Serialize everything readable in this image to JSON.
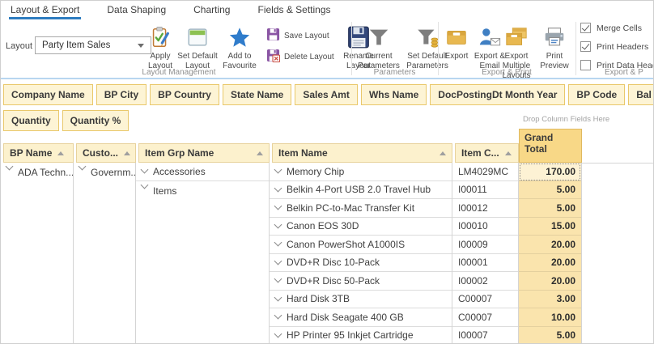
{
  "tabs": [
    {
      "label": "Layout & Export",
      "active": true
    },
    {
      "label": "Data Shaping",
      "active": false
    },
    {
      "label": "Charting",
      "active": false
    },
    {
      "label": "Fields & Settings",
      "active": false
    }
  ],
  "ribbon": {
    "layout_field": {
      "label": "Layout",
      "value": "Party Item Sales"
    },
    "layout_group": {
      "label": "Layout Management",
      "apply": "Apply Layout",
      "set_default": "Set Default Layout",
      "favourite": "Add to Favourite",
      "save": "Save Layout",
      "delete": "Delete Layout",
      "rename": "Rename Layout"
    },
    "param_group": {
      "label": "Parameters",
      "current": "Current Parameters",
      "set_default": "Set Default Parameters"
    },
    "export_group": {
      "label": "Export & Print",
      "export": "Export",
      "email": "Export & Email",
      "multiple": "Export Multiple Layouts",
      "preview": "Print Preview"
    },
    "options_group": {
      "label": "Export & P",
      "checkboxes": [
        {
          "label": "Merge Cells",
          "checked": true
        },
        {
          "label": "Print Headers",
          "checked": true
        },
        {
          "label": "Print Data Headers",
          "checked": false
        }
      ]
    }
  },
  "fields": {
    "row1": [
      "Company Name",
      "BP City",
      "BP Country",
      "State Name",
      "Sales Amt",
      "Whs Name",
      "DocPostingDt Month Year",
      "BP Code",
      "Bal Due On Doc"
    ],
    "row2": [
      "Quantity",
      "Quantity %"
    ],
    "drop_hint": "Drop Column Fields Here"
  },
  "pivot": {
    "grand_total": "Grand Total",
    "headers": {
      "c0": "BP Name",
      "c1": "Custo...",
      "c2": "Item Grp Name",
      "c3": "Item Name",
      "c4": "Item C..."
    },
    "groups": {
      "bp": "ADA Techn...",
      "customer": "Governm...",
      "grp1": "Accessories",
      "grp2": "Items"
    },
    "rows": [
      {
        "name": "Memory Chip",
        "code": "LM4029MC",
        "value": "170.00",
        "selected": true
      },
      {
        "name": "Belkin 4-Port USB 2.0 Travel Hub",
        "code": "I00011",
        "value": "5.00",
        "selected": false
      },
      {
        "name": "Belkin PC-to-Mac Transfer Kit",
        "code": "I00012",
        "value": "5.00",
        "selected": false
      },
      {
        "name": "Canon EOS 30D",
        "code": "I00010",
        "value": "15.00",
        "selected": false
      },
      {
        "name": "Canon PowerShot A1000IS",
        "code": "I00009",
        "value": "20.00",
        "selected": false
      },
      {
        "name": "DVD+R Disc 10-Pack",
        "code": "I00001",
        "value": "20.00",
        "selected": false
      },
      {
        "name": "DVD+R Disc 50-Pack",
        "code": "I00002",
        "value": "20.00",
        "selected": false
      },
      {
        "name": "Hard Disk 3TB",
        "code": "C00007",
        "value": "3.00",
        "selected": false
      },
      {
        "name": "Hard Disk Seagate 400 GB",
        "code": "C00007",
        "value": "10.00",
        "selected": false
      },
      {
        "name": "HP Printer 95 Inkjet Cartridge",
        "code": "I00007",
        "value": "5.00",
        "selected": false
      }
    ]
  },
  "colors": {
    "accent_blue": "#2e7cc0",
    "chip_bg": "#fdf4d5",
    "chip_border": "#e9c86b",
    "header_bg": "#fcf1cd",
    "grand_total_bg": "#f8d887",
    "value_bg": "#fae4ad"
  }
}
